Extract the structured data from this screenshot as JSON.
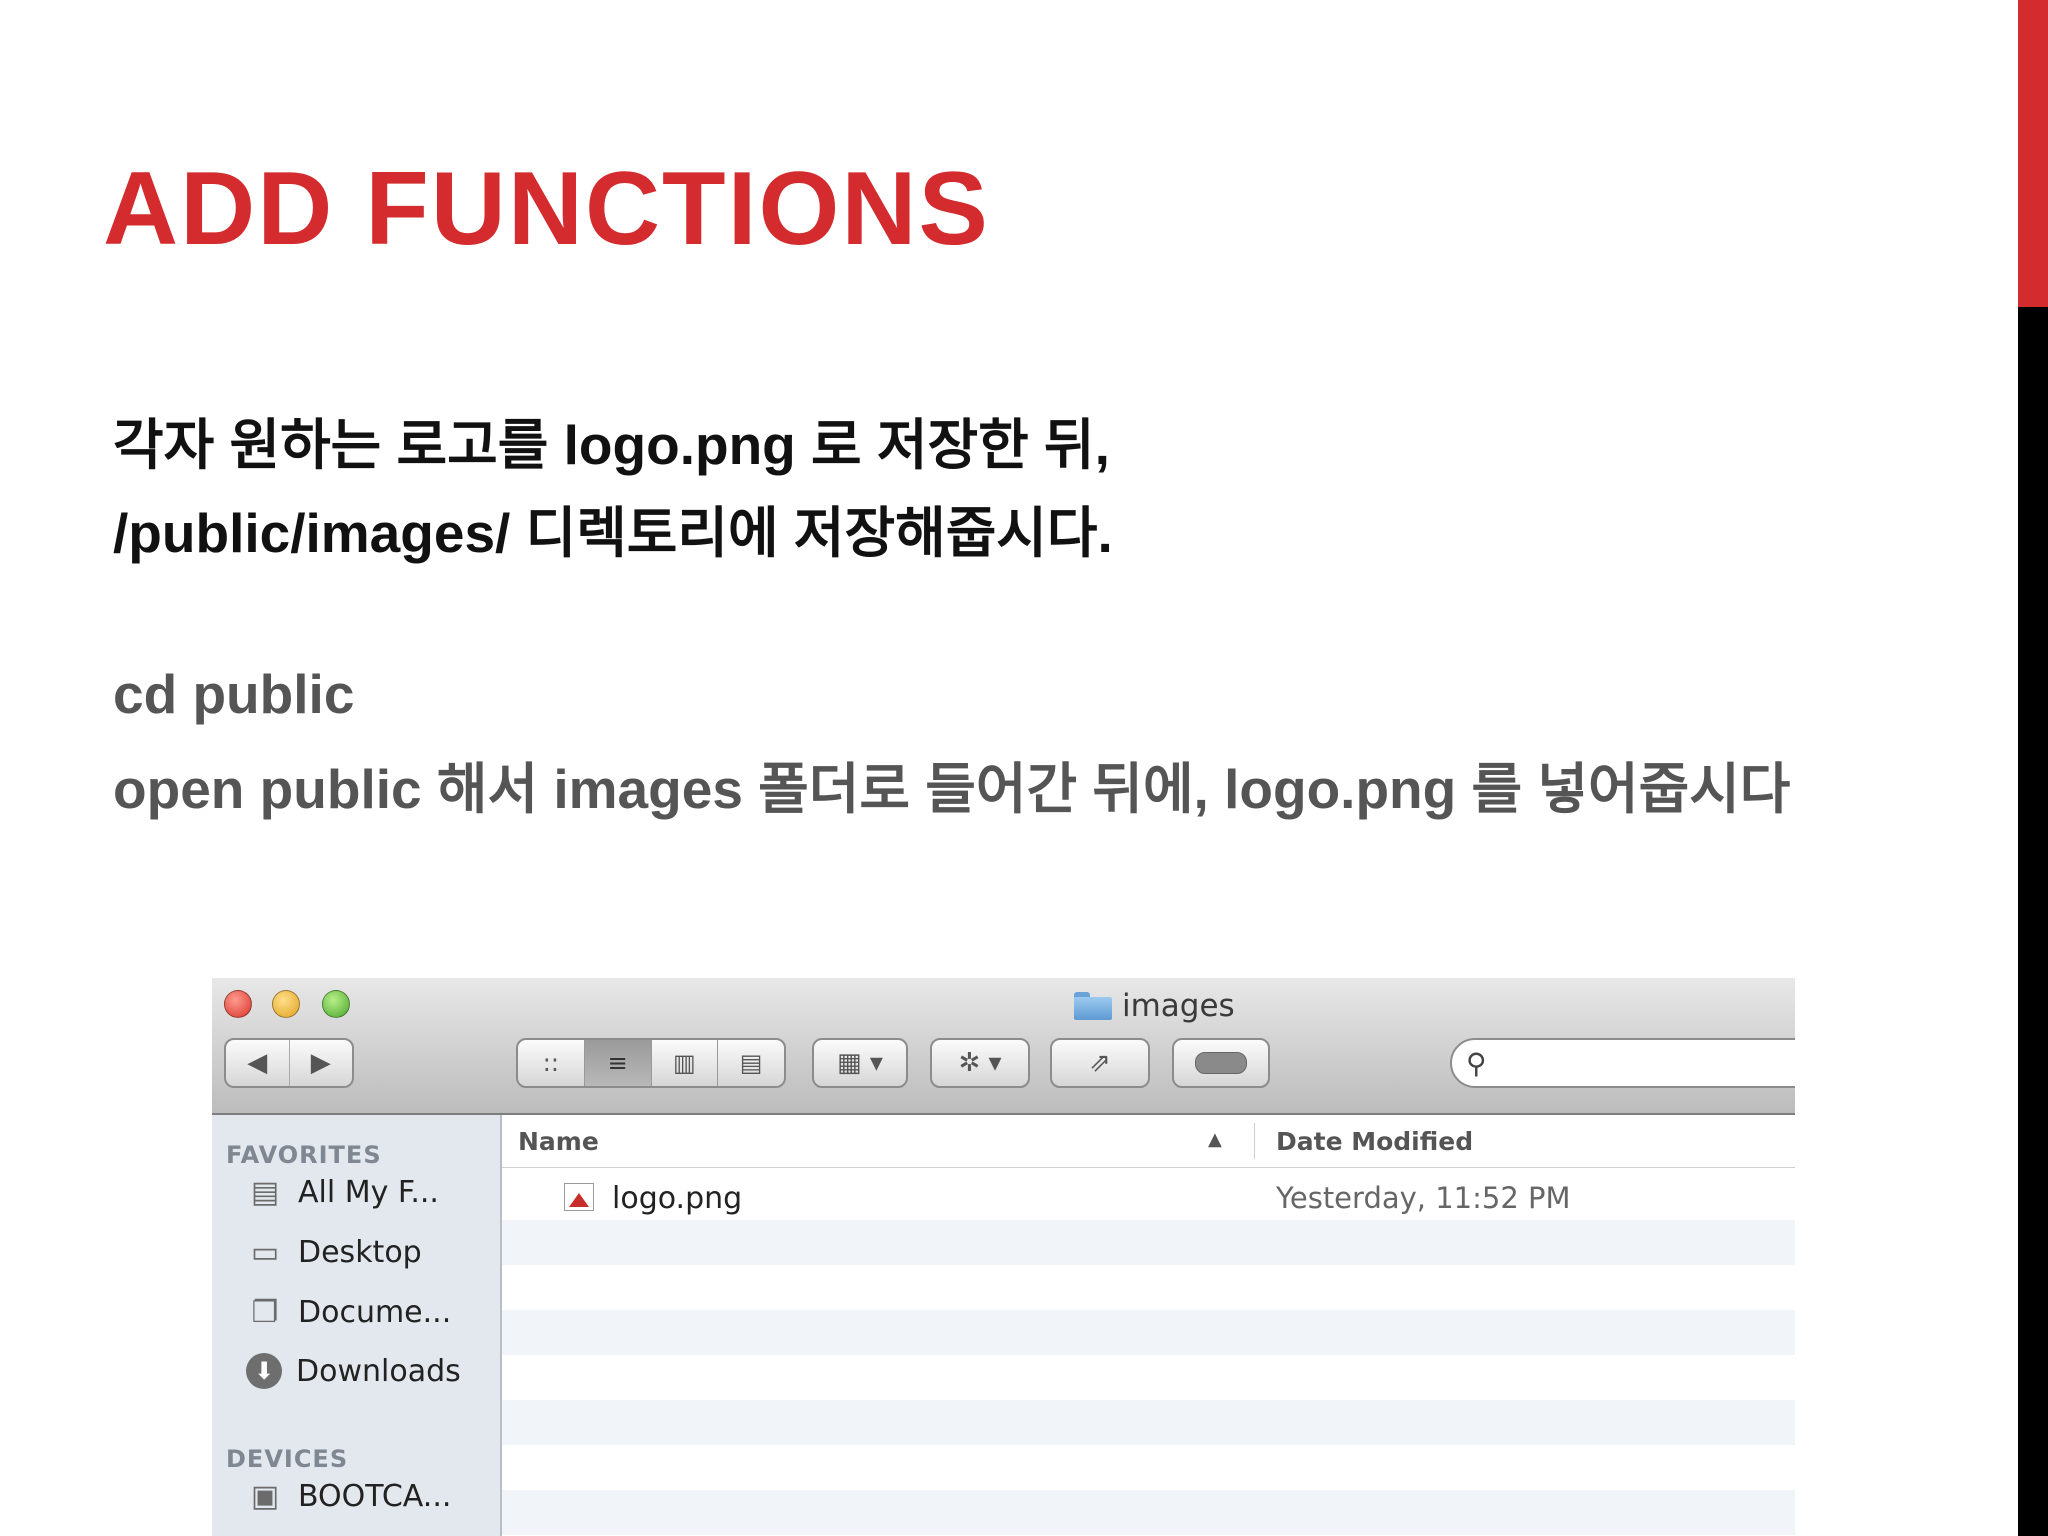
{
  "slide": {
    "title": "ADD FUNCTIONS",
    "line1": "각자 원하는 로고를 logo.png 로 저장한 뒤,",
    "line2": "/public/images/ 디렉토리에 저장해줍시다.",
    "line3": "cd public",
    "line4": "open public 해서 images 폴더로 들어간 뒤에, logo.png 를 넣어줍시다",
    "accent_color": "#d42b2f"
  },
  "finder": {
    "window_title": "images",
    "toolbar": {
      "back_icon": "◀",
      "forward_icon": "▶",
      "view_icons": [
        "::",
        "≡",
        "▥",
        "▤"
      ],
      "arrange_icon": "▦ ▾",
      "action_icon": "✲ ▾",
      "share_icon": "⇗",
      "search_icon": "⚲",
      "search_placeholder": ""
    },
    "sidebar": {
      "favorites_heading": "FAVORITES",
      "favorites": [
        {
          "label": "All My F...",
          "icon": "all-my-files-icon",
          "glyph": "▤"
        },
        {
          "label": "Desktop",
          "icon": "desktop-icon",
          "glyph": "▭"
        },
        {
          "label": "Docume...",
          "icon": "documents-icon",
          "glyph": "❐"
        },
        {
          "label": "Downloads",
          "icon": "downloads-icon",
          "glyph": "⬇"
        }
      ],
      "devices_heading": "DEVICES",
      "devices": [
        {
          "label": "BOOTCA...",
          "icon": "disk-icon",
          "glyph": "▣"
        }
      ]
    },
    "list": {
      "columns": {
        "name": "Name",
        "date": "Date Modified",
        "sort_indicator": "▲"
      },
      "files": [
        {
          "name": "logo.png",
          "date": "Yesterday, 11:52 PM"
        }
      ]
    }
  }
}
